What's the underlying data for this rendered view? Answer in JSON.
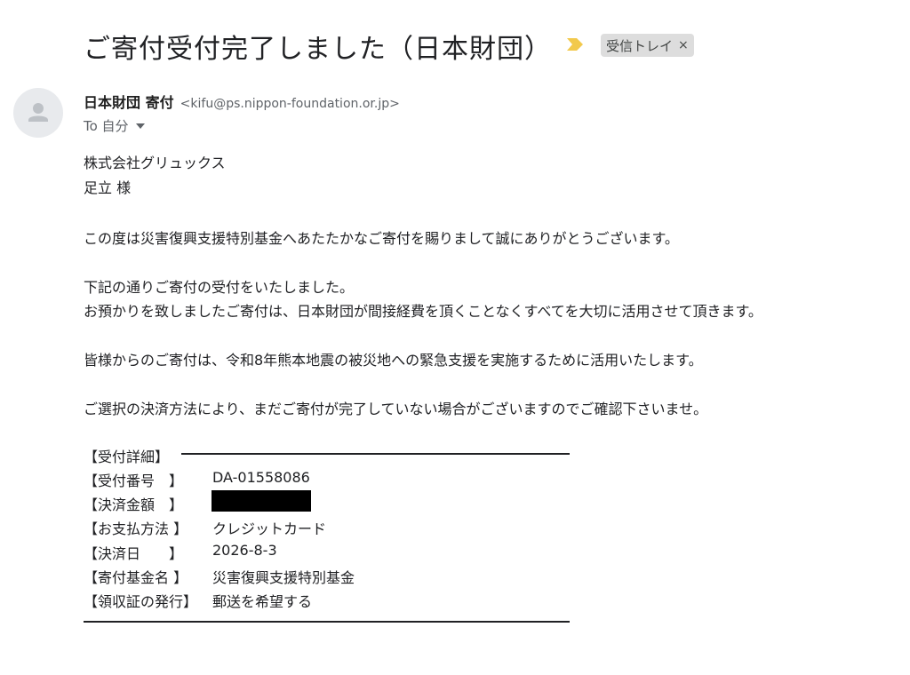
{
  "email": {
    "subject": "ご寄付受付完了しました（日本財団）",
    "label": "受信トレイ",
    "label_close": "×",
    "sender_name": "日本財団 寄付",
    "sender_email": "<kifu@ps.nippon-foundation.or.jp>",
    "recipient": "To 自分"
  },
  "body": {
    "company": "株式会社グリュックス",
    "addressee": "足立 様",
    "thanks": "この度は災害復興支援特別基金へあたたかなご寄付を賜りまして誠にありがとうございます。",
    "receipt_line1": "下記の通りご寄付の受付をいたしました。",
    "receipt_line2": "お預かりを致しましたご寄付は、日本財団が間接経費を頂くことなくすべてを大切に活用させて頂きます。",
    "usage": "皆様からのご寄付は、令和8年熊本地震の被災地への緊急支援を実施するために活用いたします。",
    "notice": "ご選択の決済方法により、まだご寄付が完了していない場合がございますのでご確認下さいませ。"
  },
  "details": {
    "heading": "【受付詳細】",
    "rows": [
      {
        "label": "【受付番号　】",
        "value": "DA-01558086"
      },
      {
        "label": "【決済金額　】",
        "value": ""
      },
      {
        "label": "【お支払方法 】",
        "value": "クレジットカード"
      },
      {
        "label": "【決済日　　】",
        "value": "2026-8-3"
      },
      {
        "label": "【寄付基金名 】",
        "value": "災害復興支援特別基金"
      },
      {
        "label": "【領収証の発行】",
        "value": "郵送を希望する"
      }
    ]
  },
  "colors": {
    "importance": "#f2c94c",
    "chip_bg": "#dddddd",
    "redaction": "#000000"
  },
  "icons": {
    "importance": "importance-marker-icon",
    "avatar": "person-icon",
    "caret": "chevron-down-icon"
  }
}
